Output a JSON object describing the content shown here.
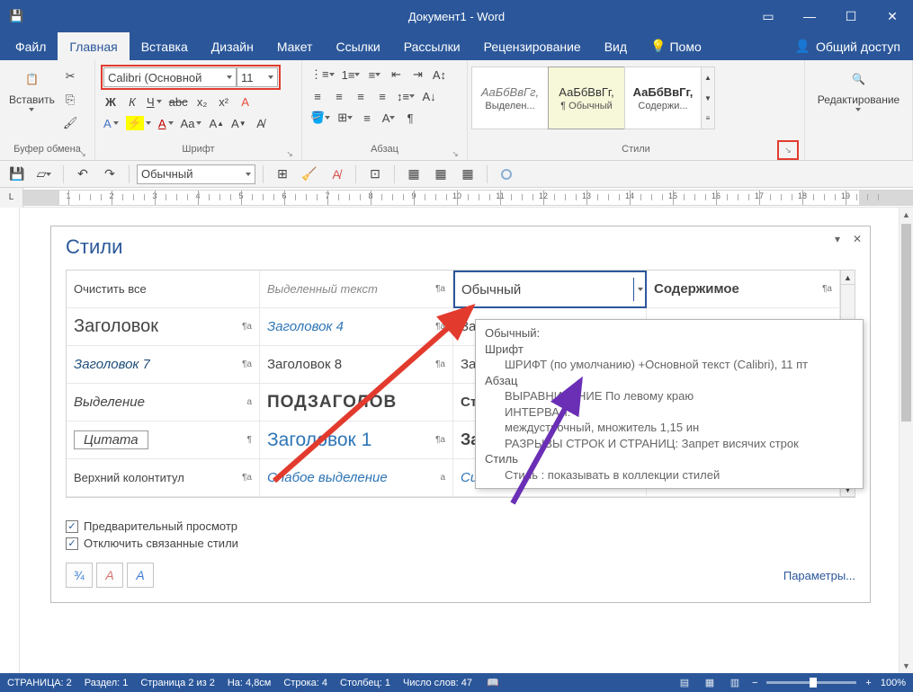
{
  "title": "Документ1 - Word",
  "tabs": {
    "file": "Файл",
    "home": "Главная",
    "insert": "Вставка",
    "design": "Дизайн",
    "layout": "Макет",
    "references": "Ссылки",
    "mailings": "Рассылки",
    "review": "Рецензирование",
    "view": "Вид",
    "help": "Помо",
    "share": "Общий доступ"
  },
  "ribbon": {
    "clipboard": {
      "paste": "Вставить",
      "label": "Буфер обмена"
    },
    "font": {
      "name": "Calibri (Основной",
      "size": "11",
      "label": "Шрифт"
    },
    "paragraph": {
      "label": "Абзац"
    },
    "styles": {
      "label": "Стили",
      "items": [
        {
          "sample": "АаБбВвГг,",
          "name": "Выделен..."
        },
        {
          "sample": "АаБбВвГг,",
          "name": "¶ Обычный"
        },
        {
          "sample": "АаБбВвГг,",
          "name": "Содержи..."
        }
      ]
    },
    "editing": {
      "label": "Редактирование"
    }
  },
  "qat": {
    "style_combo": "Обычный"
  },
  "ruler": {
    "numbers": [
      "1",
      "2",
      "3",
      "4",
      "5",
      "6",
      "7",
      "8",
      "9",
      "10",
      "11",
      "12",
      "13",
      "14",
      "15",
      "16",
      "17",
      "18",
      "19"
    ]
  },
  "styles_pane": {
    "title": "Стили",
    "grid": {
      "r0c0": "Очистить все",
      "r0c1": "Выделенный текст",
      "r0c2": "Обычный",
      "r0c3": "Содержимое",
      "r1c0": "Заголовок",
      "r1c1": "Заголовок 4",
      "r1c2": "Заго",
      "r1c3": "",
      "r2c0": "Заголовок 7",
      "r2c1": "Заголовок 8",
      "r2c2": "Заго",
      "r2c3": "",
      "r3c0": "Выделение",
      "r3c1": "ПОДЗАГОЛОВ",
      "r3c2": "Стро",
      "r3c3": "",
      "r4c0": "Цитата",
      "r4c1": "Заголовок 1",
      "r4c2": "Заг",
      "r4c3": "",
      "r5c0": "Верхний колонтитул",
      "r5c1": "Слабое выделение",
      "r5c2": "Силь",
      "r5c3": ""
    },
    "chk_preview": "Предварительный просмотр",
    "chk_linked": "Отключить связанные стили",
    "options": "Параметры..."
  },
  "tooltip": {
    "name": "Обычный:",
    "h_font": "Шрифт",
    "font_line": "ШРИФТ (по умолчанию) +Основной текст (Calibri), 11 пт",
    "h_para": "Абзац",
    "align_line": "ВЫРАВНИВАНИЕ По левому краю",
    "interval_line": "ИНТЕРВАЛ:",
    "line_spacing": "междустрочный,  множитель 1,15 ин",
    "page_breaks": "РАЗРЫВЫ СТРОК И СТРАНИЦ: Запрет висячих строк",
    "h_style": "Стиль",
    "style_line": "Стиль : показывать в коллекции стилей"
  },
  "statusbar": {
    "page": "СТРАНИЦА: 2",
    "section": "Раздел: 1",
    "page_of": "Страница 2 из 2",
    "at": "На: 4,8см",
    "line": "Строка: 4",
    "col": "Столбец: 1",
    "words": "Число слов: 47",
    "zoom": "100%"
  }
}
